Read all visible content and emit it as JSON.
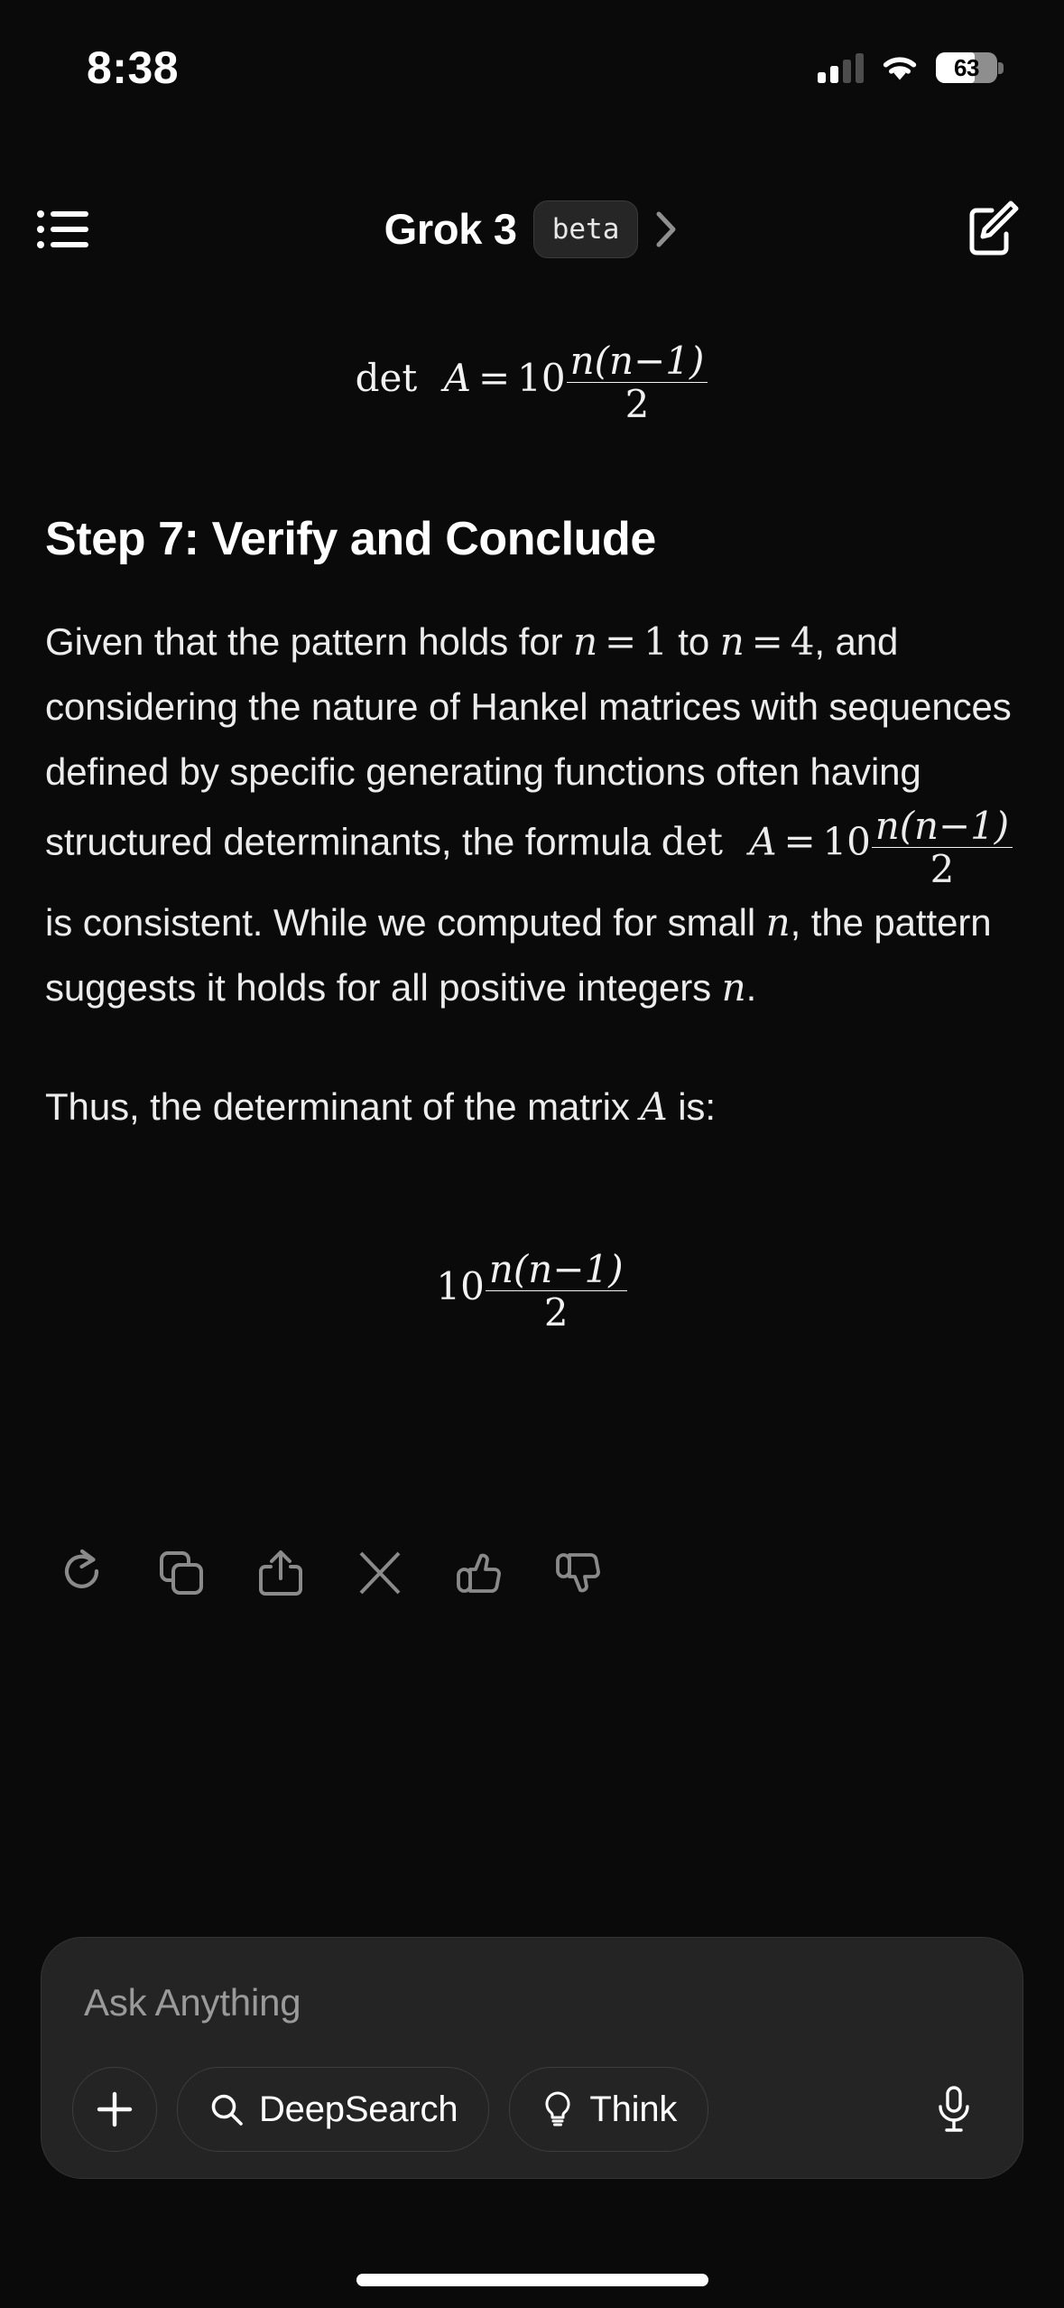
{
  "status_bar": {
    "time": "8:38",
    "battery_level": "63",
    "battery_percent": 63,
    "cellular_icon": "cellular-bars-icon",
    "wifi_icon": "wifi-icon",
    "battery_icon": "battery-icon"
  },
  "header": {
    "menu_icon": "list-menu-icon",
    "title": "Grok 3",
    "badge": "beta",
    "chevron_icon": "chevron-right-icon",
    "compose_icon": "compose-icon"
  },
  "message": {
    "top_formula": {
      "lhs": "det",
      "matrix": "A",
      "equals": "=",
      "base": "10",
      "exponent_numerator": "n(n−1)",
      "exponent_denominator": "2"
    },
    "heading": "Step 7: Verify and Conclude",
    "paragraph": {
      "seg1": "Given that the pattern holds for ",
      "math1_var": "n",
      "math1_eq": "=",
      "math1_val": "1",
      "seg2": " to ",
      "math2_var": "n",
      "math2_eq": "=",
      "math2_val": "4",
      "seg3": ", and considering the nature of Hankel matrices with sequences defined by specific generating functions often having structured determinants, the formula ",
      "math3_det": "det",
      "math3_matrix": "A",
      "math3_eq": "=",
      "math3_base": "10",
      "math3_num": "n(n−1)",
      "math3_den": "2",
      "seg4": " is consistent. While we computed for small ",
      "math4_var": "n",
      "seg5": ", the pattern suggests it holds for all positive integers ",
      "math5_var": "n",
      "seg6": "."
    },
    "conclusion": {
      "seg1": "Thus, the determinant of the matrix ",
      "math_matrix": "A",
      "seg2": " is:"
    },
    "final_formula": {
      "base": "10",
      "exponent_numerator": "n(n−1)",
      "exponent_denominator": "2"
    }
  },
  "actions": [
    {
      "name": "regenerate-button",
      "icon": "refresh-icon"
    },
    {
      "name": "copy-button",
      "icon": "copy-icon"
    },
    {
      "name": "share-button",
      "icon": "share-icon"
    },
    {
      "name": "post-to-x-button",
      "icon": "x-logo-icon"
    },
    {
      "name": "thumbs-up-button",
      "icon": "thumbs-up-icon"
    },
    {
      "name": "thumbs-down-button",
      "icon": "thumbs-down-icon"
    }
  ],
  "composer": {
    "placeholder": "Ask Anything",
    "attach_icon": "plus-icon",
    "deepsearch_label": "DeepSearch",
    "deepsearch_icon": "search-icon",
    "think_label": "Think",
    "think_icon": "lightbulb-icon",
    "mic_icon": "microphone-icon"
  },
  "colors": {
    "background": "#0a0a0a",
    "composer_fill": "#242424",
    "composer_border": "#343434",
    "text_primary": "#ececec",
    "text_placeholder": "#9a9a9a",
    "icon_muted": "#8a8a8a"
  }
}
